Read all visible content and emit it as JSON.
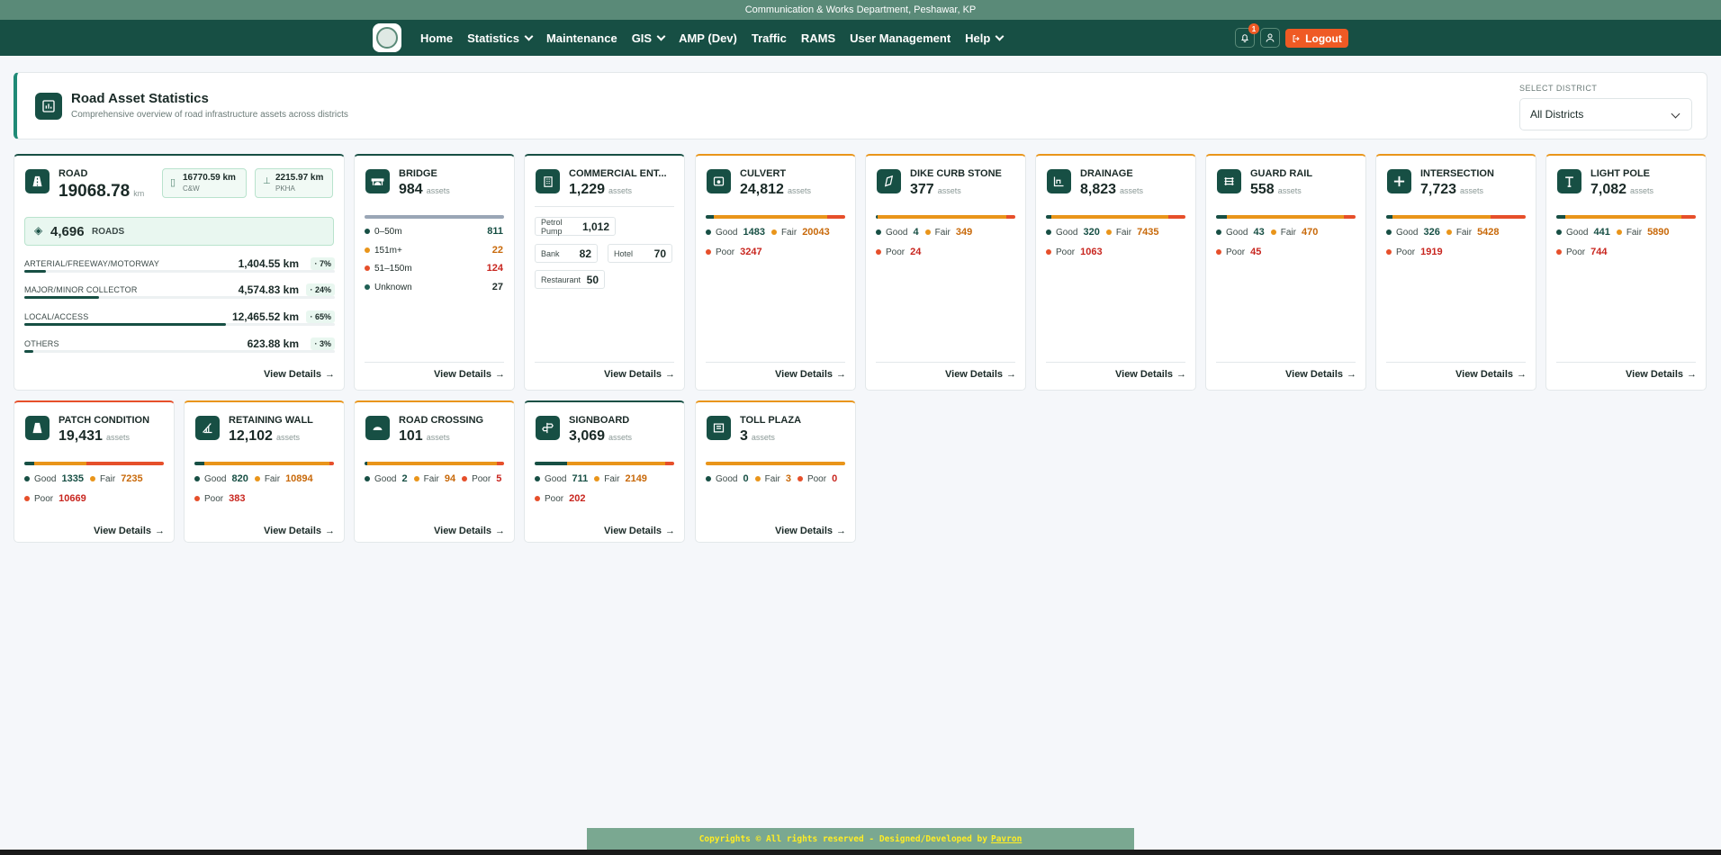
{
  "topbar": {
    "text": "Communication & Works Department, Peshawar, KP"
  },
  "nav": {
    "items": [
      {
        "label": "Home",
        "dropdown": false
      },
      {
        "label": "Statistics",
        "dropdown": true
      },
      {
        "label": "Maintenance",
        "dropdown": false
      },
      {
        "label": "GIS",
        "dropdown": true
      },
      {
        "label": "AMP (Dev)",
        "dropdown": false
      },
      {
        "label": "Traffic",
        "dropdown": false
      },
      {
        "label": "RAMS",
        "dropdown": false
      },
      {
        "label": "User Management",
        "dropdown": false
      },
      {
        "label": "Help",
        "dropdown": true
      }
    ],
    "notification_count": "1",
    "logout_label": "Logout"
  },
  "header": {
    "title": "Road Asset Statistics",
    "subtitle": "Comprehensive overview of road infrastructure assets across districts",
    "district_label": "SELECT DISTRICT",
    "district_value": "All Districts"
  },
  "road": {
    "title": "ROAD",
    "total": "19068.78",
    "unit": "km",
    "cw_value": "16770.59 km",
    "cw_label": "C&W",
    "pkha_value": "2215.97 km",
    "pkha_label": "PKHA",
    "roads_count": "4,696",
    "roads_label": "ROADS",
    "rows": [
      {
        "label": "ARTERIAL/FREEWAY/MOTORWAY",
        "value": "1,404.55 km",
        "pct": "7%",
        "frac": 0.07
      },
      {
        "label": "MAJOR/MINOR COLLECTOR",
        "value": "4,574.83 km",
        "pct": "24%",
        "frac": 0.24
      },
      {
        "label": "LOCAL/ACCESS",
        "value": "12,465.52 km",
        "pct": "65%",
        "frac": 0.65
      },
      {
        "label": "OTHERS",
        "value": "623.88 km",
        "pct": "3%",
        "frac": 0.03
      }
    ],
    "view": "View Details"
  },
  "bridge": {
    "title": "BRIDGE",
    "count": "984",
    "unit": "assets",
    "rows": [
      {
        "label": "0–50m",
        "value": "811",
        "color": "#174f44"
      },
      {
        "label": "151m+",
        "value": "22",
        "color": "#e9951a"
      },
      {
        "label": "51–150m",
        "value": "124",
        "color": "#e64f2a"
      },
      {
        "label": "Unknown",
        "value": "27",
        "color": "#1f5f54"
      }
    ],
    "view": "View Details"
  },
  "commercial": {
    "title": "COMMERCIAL ENT...",
    "count": "1,229",
    "unit": "assets",
    "items": [
      {
        "label": "Petrol Pump",
        "value": "1,012"
      },
      {
        "label": "Bank",
        "value": "82"
      },
      {
        "label": "Hotel",
        "value": "70"
      },
      {
        "label": "Restaurant",
        "value": "50"
      }
    ],
    "view": "View Details"
  },
  "conditions": {
    "good": "Good",
    "fair": "Fair",
    "poor": "Poor",
    "view": "View Details",
    "unit": "assets"
  },
  "cards": [
    {
      "title": "CULVERT",
      "count": "24,812",
      "good": "1483",
      "fair": "20043",
      "poor": "3247"
    },
    {
      "title": "DIKE CURB STONE",
      "count": "377",
      "good": "4",
      "fair": "349",
      "poor": "24"
    },
    {
      "title": "DRAINAGE",
      "count": "8,823",
      "good": "320",
      "fair": "7435",
      "poor": "1063"
    },
    {
      "title": "GUARD RAIL",
      "count": "558",
      "good": "43",
      "fair": "470",
      "poor": "45"
    },
    {
      "title": "INTERSECTION",
      "count": "7,723",
      "good": "326",
      "fair": "5428",
      "poor": "1919"
    },
    {
      "title": "LIGHT POLE",
      "count": "7,082",
      "good": "441",
      "fair": "5890",
      "poor": "744"
    },
    {
      "title": "PATCH CONDITION",
      "count": "19,431",
      "good": "1335",
      "fair": "7235",
      "poor": "10669"
    },
    {
      "title": "RETAINING WALL",
      "count": "12,102",
      "good": "820",
      "fair": "10894",
      "poor": "383"
    },
    {
      "title": "ROAD CROSSING",
      "count": "101",
      "good": "2",
      "fair": "94",
      "poor": "5"
    },
    {
      "title": "SIGNBOARD",
      "count": "3,069",
      "good": "711",
      "fair": "2149",
      "poor": "202"
    },
    {
      "title": "TOLL PLAZA",
      "count": "3",
      "good": "0",
      "fair": "3",
      "poor": "0"
    }
  ],
  "footer": {
    "text": "Copyrights © All rights reserved - Designed/Developed by",
    "link": "Pavron"
  },
  "colors": {
    "primary": "#174f44",
    "good": "#174f44",
    "fair": "#e9951a",
    "poor": "#e64f2a",
    "logout": "#ef5a24"
  }
}
